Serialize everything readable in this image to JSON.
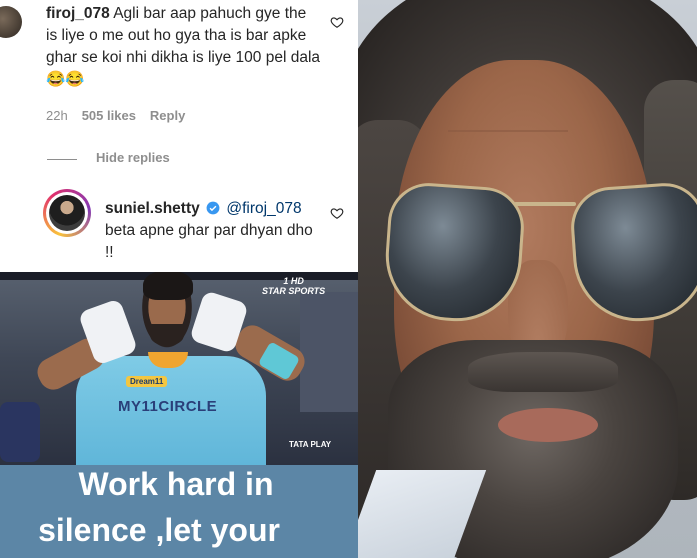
{
  "comment": {
    "username": "firoj_078",
    "text": "Agli bar aap pahuch gye the is liye o me out ho gya tha is bar apke ghar se koi nhi dikha is liye 100 pel dala 😂😂",
    "time": "22h",
    "likes": "505 likes",
    "reply": "Reply",
    "hide_replies": "Hide replies"
  },
  "reply": {
    "username": "suniel.shetty",
    "mention": "@firoj_078",
    "text": "beta apne ghar par dhyan dho !!"
  },
  "cricket": {
    "channel": "STAR SPORTS",
    "hd": "1 HD",
    "sponsor_dream": "Dream11",
    "sponsor_circle": "MY11CIRCLE",
    "tata": "TATA PLAY"
  },
  "caption": {
    "line1": "Work hard in",
    "line2": "silence ,let your"
  },
  "colors": {
    "caption_bg": "#5c86a6",
    "text": "#262626",
    "muted": "#8e8e8e",
    "verified": "#3897f0"
  }
}
